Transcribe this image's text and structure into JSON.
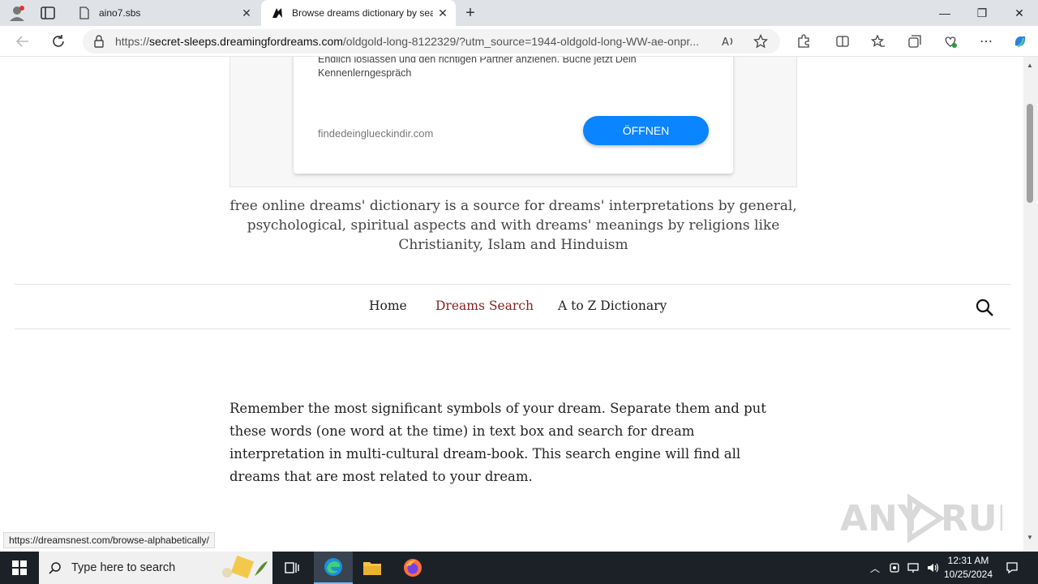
{
  "browser": {
    "tabs": [
      {
        "title": "aino7.sbs",
        "active": false
      },
      {
        "title": "Browse dreams dictionary by sea",
        "active": true
      }
    ],
    "address": {
      "scheme": "https://",
      "host": "secret-sleeps.dreamingfordreams.com",
      "path": "/oldgold-long-8122329/?utm_source=1944-oldgold-long-WW-ae-onpr..."
    },
    "window_controls": {
      "minimize": "—",
      "restore": "❐",
      "close": "✕"
    }
  },
  "ad": {
    "text": "Endlich loslassen und den richtigen Partner anziehen. Buche jetzt Dein Kennenlerngespräch",
    "domain": "findedeinglueckindir.com",
    "button": "ÖFFNEN"
  },
  "tagline": "free online dreams' dictionary is a source for dreams' interpretations by general, psychological, spiritual aspects and with dreams' meanings by religions like Christianity, Islam and Hinduism",
  "nav": {
    "items": [
      {
        "label": "Home"
      },
      {
        "label": "Dreams Search"
      },
      {
        "label": "A to Z Dictionary"
      }
    ]
  },
  "intro": "Remember the most significant symbols of your dream. Separate them and put these words (one word at the time) in text box and search for dream interpretation in multi-cultural dream-book. This search engine will find all dreams that are most related to your dream.",
  "status_url": "https://dreamsnest.com/browse-alphabetically/",
  "watermark": "ANY RUN",
  "taskbar": {
    "search_placeholder": "Type here to search",
    "time": "12:31 AM",
    "date": "10/25/2024"
  },
  "colors": {
    "accent_nav": "#8b1e1e",
    "ad_button": "#0a84ff"
  }
}
